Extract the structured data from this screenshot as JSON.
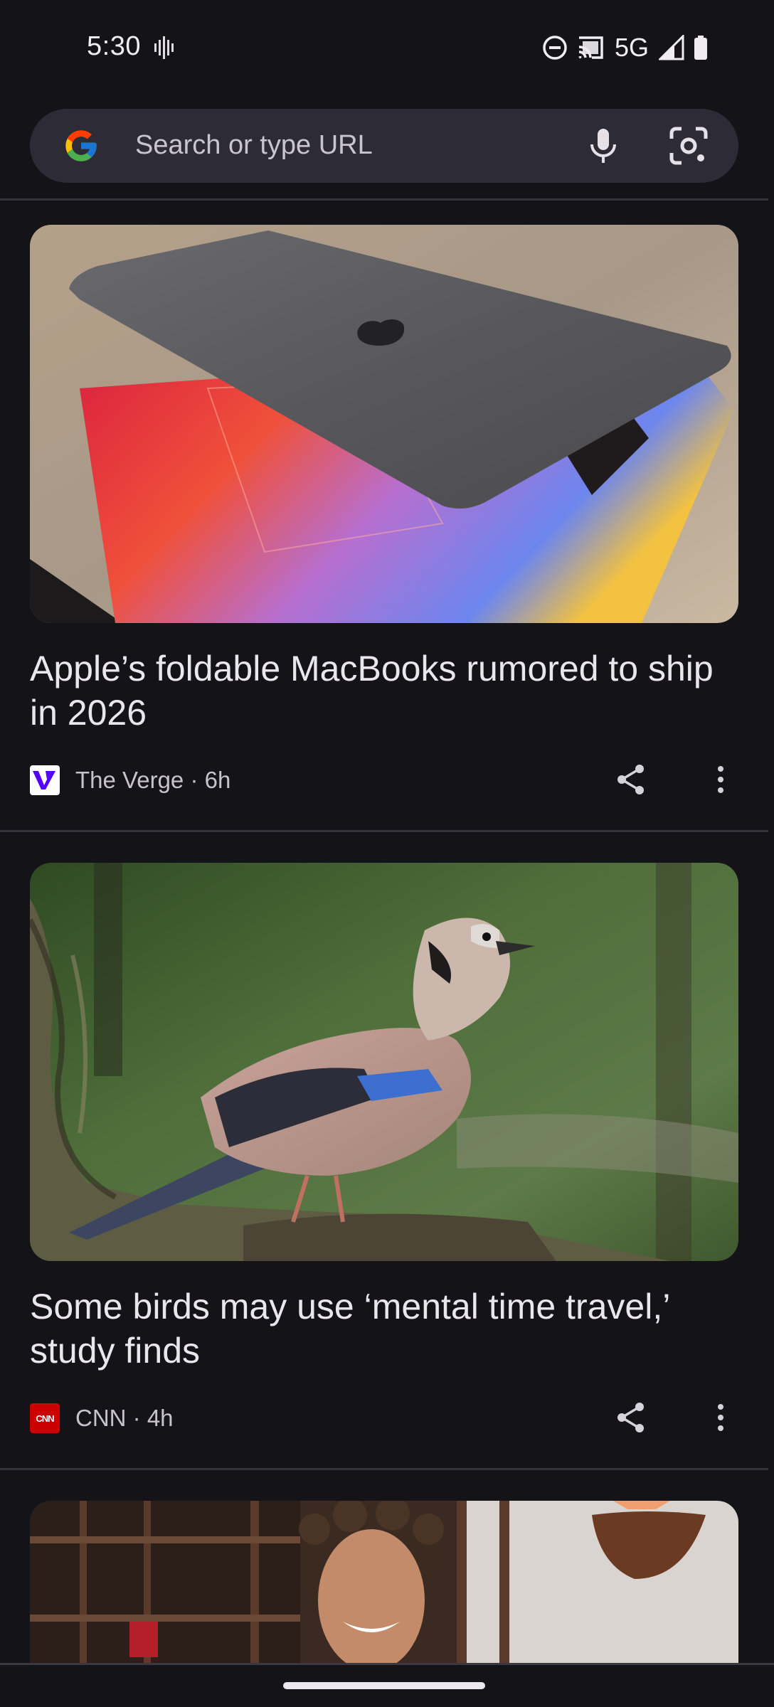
{
  "status_bar": {
    "time": "5:30",
    "network": "5G",
    "icons": [
      "vibrate-icon",
      "do-not-disturb-icon",
      "cast-icon",
      "signal-icon",
      "battery-icon"
    ]
  },
  "search": {
    "placeholder": "Search or type URL",
    "icons": [
      "google-logo-icon",
      "microphone-icon",
      "lens-icon"
    ]
  },
  "articles": [
    {
      "title": "Apple’s foldable MacBooks rumored to ship in 2026",
      "source": "The Verge",
      "time": "6h",
      "byline": "The Verge · 6h",
      "image": "macbook-photo"
    },
    {
      "title": "Some birds may use ‘mental time travel,’ study finds",
      "source": "CNN",
      "time": "4h",
      "byline": "CNN · 4h",
      "source_logo_text": "CNN",
      "image": "jay-bird-photo"
    },
    {
      "image": "woman-kitchen-photo"
    }
  ],
  "colors": {
    "background": "#131318",
    "search_bar": "#2c2b36",
    "cnn_red": "#cc0000",
    "verge_purple": "#5200ff"
  }
}
